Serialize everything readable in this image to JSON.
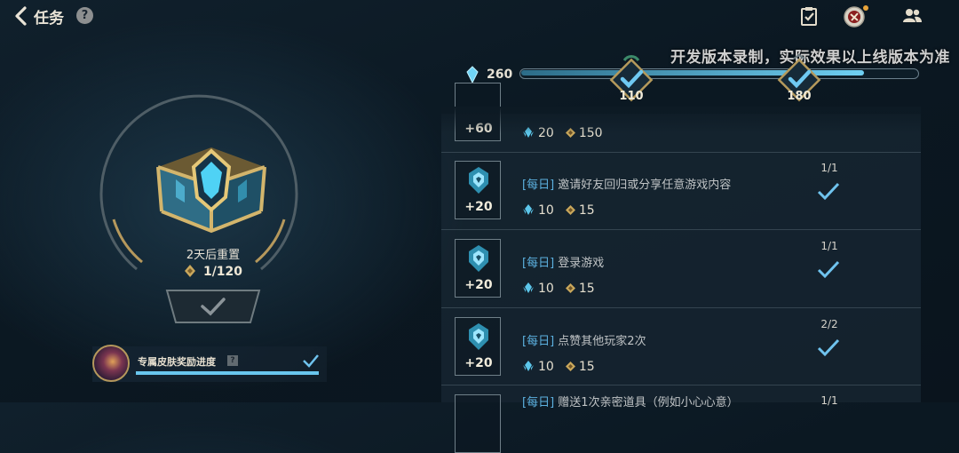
{
  "header": {
    "title": "任务",
    "help_label": "?"
  },
  "watermark": "开发版本录制，实际效果以上线版本为准",
  "progress": {
    "total": "260",
    "fill_fraction": 0.87,
    "milestones": [
      {
        "label": "110",
        "completed": true
      },
      {
        "label": "180",
        "completed": true
      }
    ]
  },
  "chest": {
    "reset_text": "2天后重置",
    "progress_text": "1/120"
  },
  "skin_reward": {
    "label": "专属皮肤奖励进度",
    "help_label": "?",
    "completed": true
  },
  "quests": [
    {
      "exp": "+60",
      "title_tag": "",
      "title": "",
      "gem": "20",
      "coin": "150",
      "count": "",
      "completed": false,
      "partial": true
    },
    {
      "exp": "+20",
      "title_tag": "[每日]",
      "title": "邀请好友回归或分享任意游戏内容",
      "gem": "10",
      "coin": "15",
      "count": "1/1",
      "completed": true
    },
    {
      "exp": "+20",
      "title_tag": "[每日]",
      "title": "登录游戏",
      "gem": "10",
      "coin": "15",
      "count": "1/1",
      "completed": true
    },
    {
      "exp": "+20",
      "title_tag": "[每日]",
      "title": "点赞其他玩家2次",
      "gem": "10",
      "coin": "15",
      "count": "2/2",
      "completed": true
    },
    {
      "exp": "",
      "title_tag": "[每日]",
      "title": "赠送1次亲密道具（例如小心心意）",
      "gem": "",
      "coin": "",
      "count": "1/1",
      "completed": false,
      "partial": true
    }
  ],
  "colors": {
    "accent_blue": "#5cb1e0",
    "check_blue": "#6fc3ee",
    "gold": "#b5985c"
  },
  "icons": [
    "back-arrow-icon",
    "help-icon",
    "quest-list-icon",
    "profile-emblem-icon",
    "friends-icon",
    "crystal-icon",
    "coin-icon",
    "checkmark-icon"
  ]
}
